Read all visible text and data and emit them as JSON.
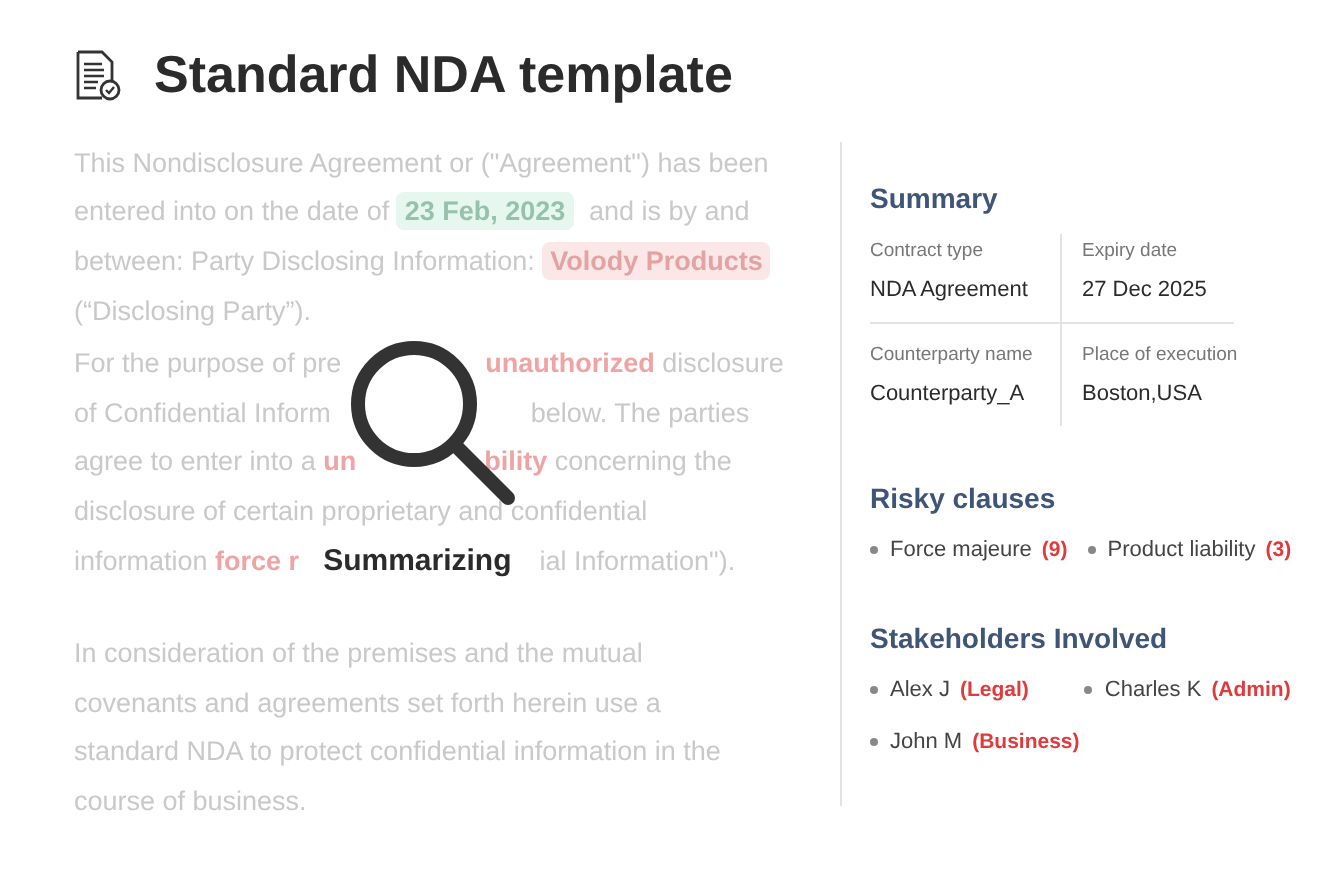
{
  "title": "Standard NDA template",
  "document": {
    "paragraphs": [
      [
        [
          {
            "kind": "plain",
            "text": "This Nondisclosure Agreement or (\"Agreement\") has been"
          }
        ],
        [
          {
            "kind": "plain",
            "text": "entered into on the date of "
          },
          {
            "kind": "date",
            "text": "23 Feb, 2023"
          },
          {
            "kind": "plain",
            "text": " and is by and"
          }
        ],
        [
          {
            "kind": "plain",
            "text": "between: Party Disclosing Information: "
          },
          {
            "kind": "party",
            "text": "Volody Products"
          }
        ],
        [
          {
            "kind": "plain",
            "text": "(“Disclosing Party”)."
          }
        ]
      ],
      [
        [
          {
            "kind": "plain",
            "text": "For the purpose of pre"
          },
          {
            "kind": "risk",
            "text": "unauthorized",
            "covered_before": true
          },
          {
            "kind": "plain",
            "text": " disclosure"
          }
        ],
        [
          {
            "kind": "plain",
            "text": "of Confidential Inform"
          },
          {
            "kind": "plain",
            "text": "below. The parties",
            "covered_before": true
          }
        ],
        [
          {
            "kind": "plain",
            "text": "agree to enter into a "
          },
          {
            "kind": "risk",
            "text": "un"
          },
          {
            "kind": "risk",
            "text": "bility",
            "covered_before": true
          },
          {
            "kind": "plain",
            "text": " concerning the"
          }
        ],
        [
          {
            "kind": "plain",
            "text": "disclosure of certain proprietary and confidential"
          }
        ],
        [
          {
            "kind": "plain",
            "text": "information "
          },
          {
            "kind": "risk",
            "text": "force r"
          },
          {
            "kind": "status",
            "text": "Summarizing"
          },
          {
            "kind": "plain",
            "text": "ial Information\")."
          }
        ]
      ],
      [
        [
          {
            "kind": "plain",
            "text": "In consideration of the premises and the mutual"
          }
        ],
        [
          {
            "kind": "plain",
            "text": "covenants and agreements set forth herein use a"
          }
        ],
        [
          {
            "kind": "plain",
            "text": "standard NDA to protect confidential information in the"
          }
        ],
        [
          {
            "kind": "plain",
            "text": "course of business."
          }
        ]
      ]
    ]
  },
  "summary": {
    "heading": "Summary",
    "fields": [
      {
        "label": "Contract type",
        "value": "NDA Agreement"
      },
      {
        "label": "Expiry date",
        "value": "27 Dec 2025"
      },
      {
        "label": "Counterparty name",
        "value": "Counterparty_A"
      },
      {
        "label": "Place of execution",
        "value": "Boston,USA"
      }
    ]
  },
  "risky_clauses": {
    "heading": "Risky clauses",
    "items": [
      {
        "name": "Force majeure",
        "count": "(9)"
      },
      {
        "name": "Product liability",
        "count": "(3)"
      }
    ]
  },
  "stakeholders": {
    "heading": "Stakeholders Involved",
    "items": [
      {
        "name": "Alex J",
        "role": "(Legal)"
      },
      {
        "name": "Charles K",
        "role": "(Admin)"
      },
      {
        "name": "John M",
        "role": "(Business)"
      }
    ]
  }
}
